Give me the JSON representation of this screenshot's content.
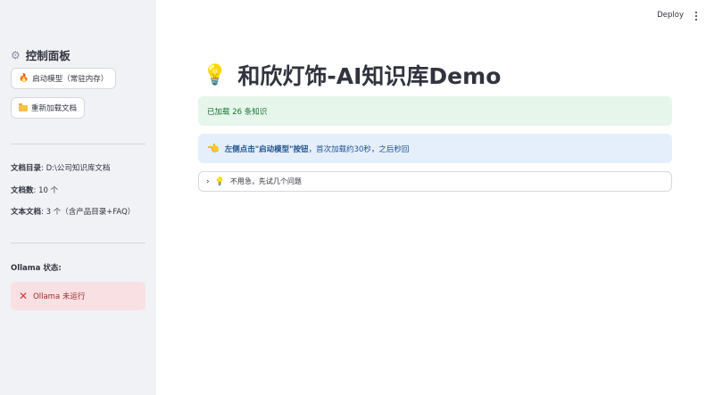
{
  "sidebar": {
    "title": "控制面板",
    "buttons": {
      "start_model": "启动模型（常驻内存）",
      "reload_docs": "重新加载文档"
    },
    "info": {
      "doc_dir_label": "文档目录",
      "doc_dir_value": ": D:\\公司知识库文档",
      "doc_count_label": "文档数",
      "doc_count_value": ": 10 个",
      "text_docs_label": "文本文档",
      "text_docs_value": ": 3 个（含产品目录+FAQ）"
    },
    "ollama": {
      "status_label": "Ollama 状态:",
      "status_text": "Ollama 未运行"
    }
  },
  "header": {
    "deploy_label": "Deploy"
  },
  "main": {
    "title": "和欣灯饰-AI知识库Demo",
    "success_text": "已加载 26 条知识",
    "info": {
      "bold": "左侧点击\"启动模型\"按钮",
      "rest": "，首次加载约30秒，之后秒回"
    },
    "expander_label": "不用急，先试几个问题"
  },
  "icons": {
    "sidebar_title": "gear-icon",
    "start_model": "fire-icon",
    "reload_docs": "folder-icon",
    "ollama_status": "x-mark-icon",
    "page_title": "lightbulb-icon",
    "info": "pointing-hand-icon",
    "expander_chevron": "chevron-right-icon",
    "expander": "lightbulb-icon",
    "menu": "kebab-menu-icon"
  },
  "colors": {
    "sidebar_bg": "#f0f2f6",
    "success_bg": "#e6f6ea",
    "success_text": "#177233",
    "info_bg": "#e5eefb",
    "info_text": "#1c5190",
    "error_bg": "#f9e0e2",
    "error_text": "#9d2a2c"
  }
}
